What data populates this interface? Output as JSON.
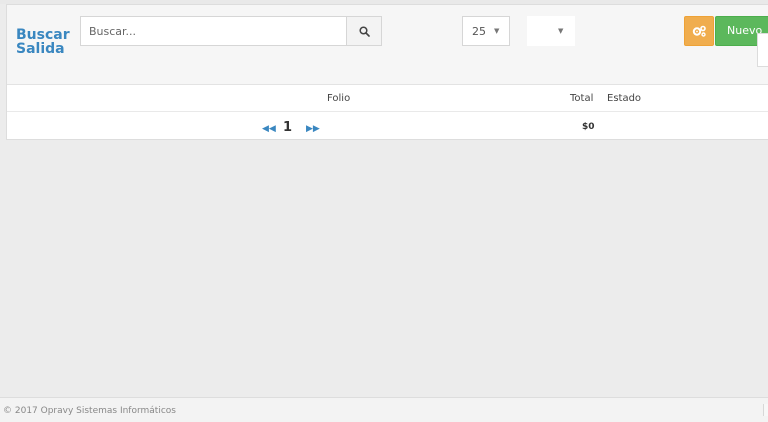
{
  "header": {
    "title": "Buscar Salida",
    "search_placeholder": "Buscar...",
    "page_size": "25",
    "second_select": "",
    "new_label": "Nuevo"
  },
  "table": {
    "columns": [
      "Folio",
      "Total",
      "Estado"
    ],
    "total_value": "$0"
  },
  "pagination": {
    "current_page": "1"
  },
  "footer": {
    "text": "© 2017 Opravy Sistemas Informáticos"
  },
  "icons": {
    "search": "search-icon",
    "settings": "gears-icon",
    "first_page": "angle-double-left-icon",
    "last_page": "angle-double-right-icon"
  },
  "colors": {
    "accent": "#3a87c0",
    "settings_button": "#f0ad4e",
    "new_button": "#5cb85c"
  }
}
